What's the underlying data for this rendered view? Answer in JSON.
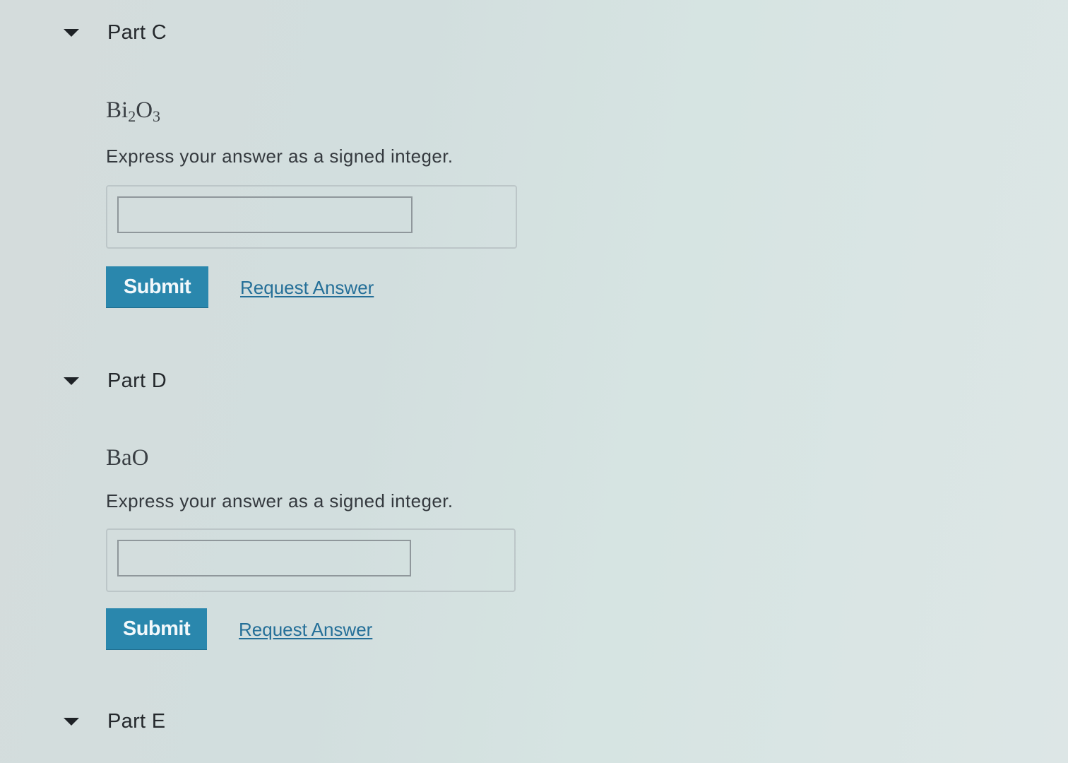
{
  "parts": [
    {
      "title": "Part C",
      "formula": {
        "base1": "Bi",
        "sub1": "2",
        "base2": "O",
        "sub2": "3"
      },
      "instruction": "Express your answer as a signed integer.",
      "answer_value": "",
      "submit_label": "Submit",
      "request_label": "Request Answer"
    },
    {
      "title": "Part D",
      "formula": {
        "text": "BaO"
      },
      "instruction": "Express your answer as a signed integer.",
      "answer_value": "",
      "submit_label": "Submit",
      "request_label": "Request Answer"
    },
    {
      "title": "Part E"
    }
  ],
  "icons": {
    "expand": "caret-down-icon"
  },
  "colors": {
    "submit_bg": "#2a87ad",
    "link": "#246f98"
  }
}
